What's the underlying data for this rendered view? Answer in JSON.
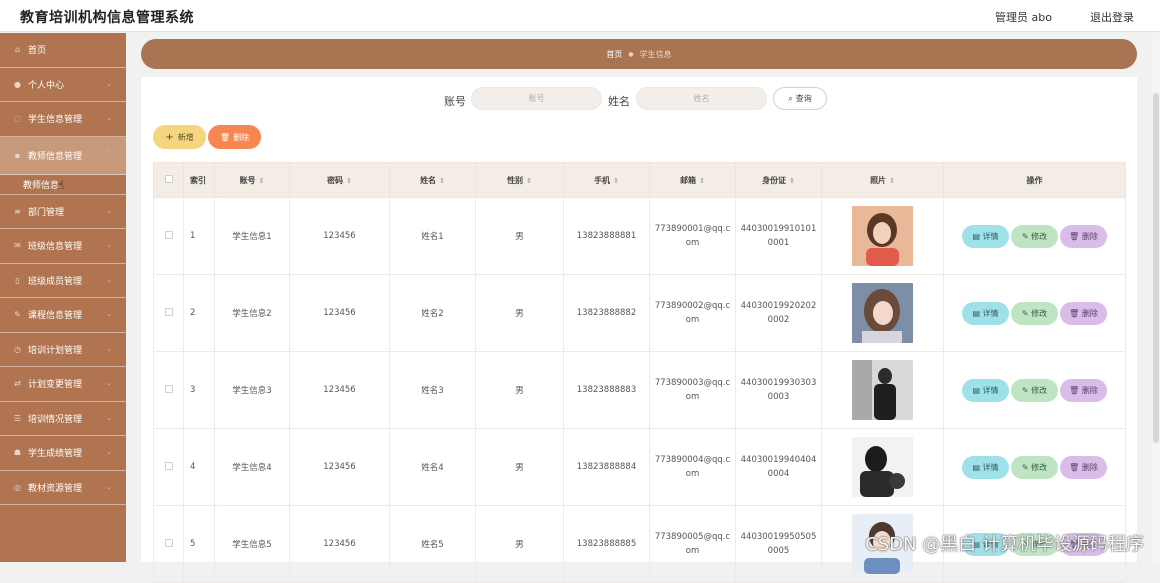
{
  "app": {
    "title": "教育培训机构信息管理系统",
    "user_label": "管理员 abo",
    "logout_label": "退出登录"
  },
  "sidebar": {
    "items": [
      {
        "label": "首页",
        "icon": "home-icon",
        "active": false
      },
      {
        "label": "个人中心",
        "icon": "user-icon",
        "active": false
      },
      {
        "label": "学生信息管理",
        "icon": "student-icon",
        "active": false
      },
      {
        "label": "教师信息管理",
        "icon": "teacher-icon",
        "active": true
      },
      {
        "label": "部门管理",
        "icon": "department-icon",
        "active": false
      },
      {
        "label": "班级信息管理",
        "icon": "class-icon",
        "active": false
      },
      {
        "label": "班级成员管理",
        "icon": "members-icon",
        "active": false
      },
      {
        "label": "课程信息管理",
        "icon": "course-icon",
        "active": false
      },
      {
        "label": "培训计划管理",
        "icon": "plan-icon",
        "active": false
      },
      {
        "label": "计划变更管理",
        "icon": "change-icon",
        "active": false
      },
      {
        "label": "培训情况管理",
        "icon": "status-icon",
        "active": false
      },
      {
        "label": "学生成绩管理",
        "icon": "score-icon",
        "active": false
      },
      {
        "label": "教材资源管理",
        "icon": "material-icon",
        "active": false
      }
    ],
    "submenu_label": "教师信息"
  },
  "breadcrumb": {
    "home": "首页",
    "current": "学生信息"
  },
  "search": {
    "account_label": "账号",
    "account_placeholder": "账号",
    "name_label": "姓名",
    "name_placeholder": "姓名",
    "query_label": "查询"
  },
  "toolbar": {
    "add_label": "新增",
    "delete_label": "删除"
  },
  "table": {
    "columns": [
      "索引",
      "账号",
      "密码",
      "姓名",
      "性别",
      "手机",
      "邮箱",
      "身份证",
      "照片",
      "操作"
    ],
    "rows": [
      {
        "index": "1",
        "account": "学生信息1",
        "password": "123456",
        "name": "姓名1",
        "gender": "男",
        "phone": "13823888881",
        "email": "773890001@qq.com",
        "idcard": "440300199101010001"
      },
      {
        "index": "2",
        "account": "学生信息2",
        "password": "123456",
        "name": "姓名2",
        "gender": "男",
        "phone": "13823888882",
        "email": "773890002@qq.com",
        "idcard": "440300199202020002"
      },
      {
        "index": "3",
        "account": "学生信息3",
        "password": "123456",
        "name": "姓名3",
        "gender": "男",
        "phone": "13823888883",
        "email": "773890003@qq.com",
        "idcard": "440300199303030003"
      },
      {
        "index": "4",
        "account": "学生信息4",
        "password": "123456",
        "name": "姓名4",
        "gender": "男",
        "phone": "13823888884",
        "email": "773890004@qq.com",
        "idcard": "440300199404040004"
      },
      {
        "index": "5",
        "account": "学生信息5",
        "password": "123456",
        "name": "姓名5",
        "gender": "男",
        "phone": "13823888885",
        "email": "773890005@qq.com",
        "idcard": "440300199505050005"
      }
    ],
    "actions": {
      "detail": "详情",
      "edit": "修改",
      "delete": "删除"
    }
  },
  "watermark": "CSDN @黑白 计算机毕设源码程序",
  "colors": {
    "sidebar": "#b07550",
    "breadcrumb": "#a87451",
    "add_button": "#f5d67f",
    "delete_button": "#f68750",
    "detail_button": "#9fe1e8",
    "edit_button": "#bfe4c4",
    "row_delete_button": "#d9bce8"
  }
}
